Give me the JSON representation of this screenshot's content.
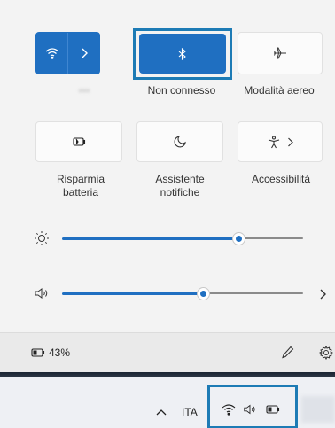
{
  "quick_settings": {
    "tiles": [
      {
        "id": "wifi",
        "icon": "wifi-icon",
        "label": "",
        "active": true
      },
      {
        "id": "bluetooth",
        "icon": "bluetooth-icon",
        "label": "Non connesso",
        "active": true
      },
      {
        "id": "airplane",
        "icon": "airplane-icon",
        "label": "Modalità aereo",
        "active": false
      },
      {
        "id": "battery-saver",
        "icon": "battery-saver-icon",
        "label": "Risparmia batteria",
        "active": false
      },
      {
        "id": "focus",
        "icon": "moon-icon",
        "label": "Assistente notifiche",
        "active": false
      },
      {
        "id": "accessibility",
        "icon": "accessibility-icon",
        "label": "Accessibilità",
        "active": false
      }
    ]
  },
  "sliders": {
    "brightness": {
      "icon": "brightness-icon",
      "value": 0.74
    },
    "volume": {
      "icon": "speaker-icon",
      "value": 0.52
    }
  },
  "footer": {
    "battery_label": "43%",
    "battery_icon": "battery-icon",
    "edit_icon": "pencil-icon",
    "settings_icon": "gear-icon"
  },
  "taskbar": {
    "language": "ITA",
    "tray_icons": [
      "wifi-icon",
      "speaker-icon",
      "battery-icon"
    ]
  },
  "colors": {
    "accent": "#1f6fc1",
    "highlight_box": "#1d7bb5"
  }
}
